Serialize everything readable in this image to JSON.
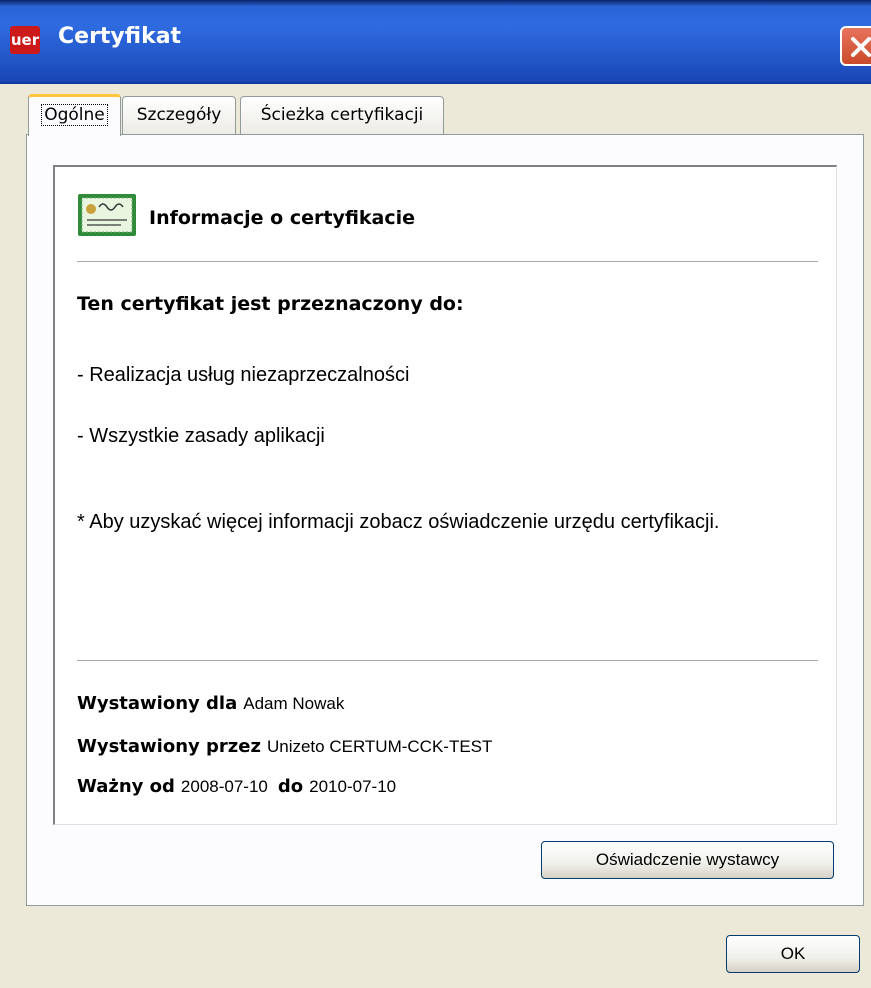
{
  "window": {
    "title": "Certyfikat",
    "app_icon_text": "uer",
    "close_icon": "close-icon"
  },
  "tabs": [
    {
      "label": "Ogólne",
      "active": true
    },
    {
      "label": "Szczegóły",
      "active": false
    },
    {
      "label": "Ścieżka certyfikacji",
      "active": false
    }
  ],
  "general": {
    "heading": "Informacje o certyfikacie",
    "purpose_heading": "Ten certyfikat jest przeznaczony do:",
    "purposes": [
      "- Realizacja usług niezaprzeczalności",
      "- Wszystkie zasady aplikacji"
    ],
    "note": "* Aby uzyskać więcej informacji zobacz oświadczenie urzędu certyfikacji.",
    "issued_to_label": "Wystawiony dla",
    "issued_to": "Adam Nowak",
    "issued_by_label": "Wystawiony przez",
    "issued_by": "Unizeto CERTUM-CCK-TEST",
    "valid_from_label": "Ważny od",
    "valid_from": "2008-07-10",
    "valid_to_label": "do",
    "valid_to": "2010-07-10"
  },
  "buttons": {
    "issuer_statement": "Oświadczenie wystawcy",
    "ok": "OK"
  },
  "colors": {
    "titlebar": "#2f6be0",
    "dialog_bg": "#ece9d8",
    "active_tab_accent": "#ffc83c"
  }
}
